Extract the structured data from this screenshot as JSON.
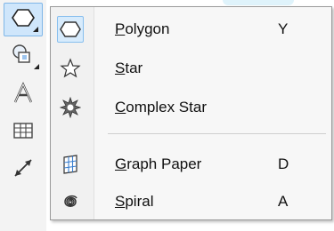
{
  "toolbox": {
    "tools": [
      {
        "icon": "polygon-tool-icon",
        "active": true
      },
      {
        "icon": "shape-tool-icon",
        "active": false
      },
      {
        "icon": "text-tool-icon",
        "active": false
      },
      {
        "icon": "table-tool-icon",
        "active": false
      },
      {
        "icon": "dimension-tool-icon",
        "active": false
      }
    ]
  },
  "menu": {
    "items": [
      {
        "mnemonic": "P",
        "rest": "olygon",
        "shortcut": "Y",
        "icon": "polygon-icon"
      },
      {
        "mnemonic": "S",
        "rest": "tar",
        "shortcut": "",
        "icon": "star-icon"
      },
      {
        "mnemonic": "C",
        "rest": "omplex Star",
        "shortcut": "",
        "icon": "complex-star-icon"
      },
      {
        "mnemonic": "G",
        "rest": "raph Paper",
        "shortcut": "D",
        "icon": "graph-paper-icon"
      },
      {
        "mnemonic": "S",
        "rest": "piral",
        "shortcut": "A",
        "icon": "spiral-icon"
      }
    ]
  },
  "colors": {
    "highlight": "#d7ebfc",
    "highlight_border": "#88bfee",
    "menu_bg": "#f7f7f7"
  }
}
